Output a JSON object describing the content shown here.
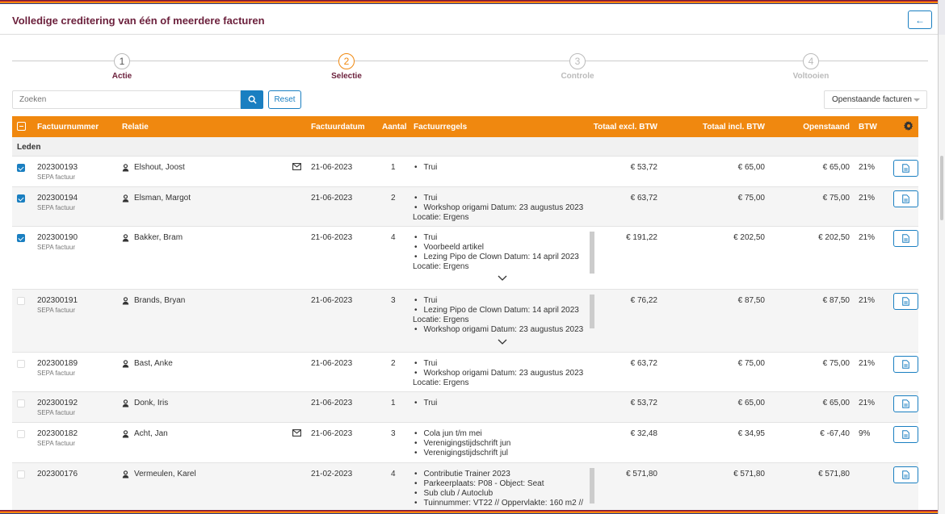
{
  "header": {
    "title": "Volledige creditering van één of meerdere facturen",
    "back_label": "←"
  },
  "steps": [
    {
      "num": "1",
      "label": "Actie"
    },
    {
      "num": "2",
      "label": "Selectie"
    },
    {
      "num": "3",
      "label": "Controle"
    },
    {
      "num": "4",
      "label": "Voltooien"
    }
  ],
  "toolbar": {
    "search_placeholder": "Zoeken",
    "reset_label": "Reset",
    "filter_value": "Openstaande facturen"
  },
  "columns": {
    "invoice": "Factuurnummer",
    "relation": "Relatie",
    "date": "Factuurdatum",
    "count": "Aantal",
    "lines": "Factuurregels",
    "excl": "Totaal excl. BTW",
    "incl": "Totaal incl. BTW",
    "open": "Openstaand",
    "btw": "BTW"
  },
  "group_label": "Leden",
  "rows": [
    {
      "checked": true,
      "number": "202300193",
      "type": "SEPA factuur",
      "relation": "Elshout, Joost",
      "mail": true,
      "date": "21-06-2023",
      "count": "1",
      "lines": [
        "Trui"
      ],
      "excl": "€ 53,72",
      "incl": "€ 65,00",
      "open": "€ 65,00",
      "btw": "21%"
    },
    {
      "checked": true,
      "number": "202300194",
      "type": "SEPA factuur",
      "relation": "Elsman, Margot",
      "mail": false,
      "date": "21-06-2023",
      "count": "2",
      "lines": [
        "Trui",
        "Workshop origami Datum: 23 augustus 2023",
        "Locatie: Ergens"
      ],
      "excl": "€ 63,72",
      "incl": "€ 75,00",
      "open": "€ 75,00",
      "btw": "21%"
    },
    {
      "checked": true,
      "number": "202300190",
      "type": "SEPA factuur",
      "relation": "Bakker, Bram",
      "mail": false,
      "date": "21-06-2023",
      "count": "4",
      "lines": [
        "Trui",
        "Voorbeeld artikel",
        "Lezing Pipo de Clown Datum: 14 april 2023",
        "Locatie: Ergens"
      ],
      "excl": "€ 191,22",
      "incl": "€ 202,50",
      "open": "€ 202,50",
      "btw": "21%"
    },
    {
      "checked": false,
      "number": "202300191",
      "type": "SEPA factuur",
      "relation": "Brands, Bryan",
      "mail": false,
      "date": "21-06-2023",
      "count": "3",
      "lines": [
        "Trui",
        "Lezing Pipo de Clown Datum: 14 april 2023",
        "Locatie: Ergens",
        "Workshop origami Datum: 23 augustus 2023"
      ],
      "excl": "€ 76,22",
      "incl": "€ 87,50",
      "open": "€ 87,50",
      "btw": "21%"
    },
    {
      "checked": false,
      "number": "202300189",
      "type": "SEPA factuur",
      "relation": "Bast, Anke",
      "mail": false,
      "date": "21-06-2023",
      "count": "2",
      "lines": [
        "Trui",
        "Workshop origami Datum: 23 augustus 2023",
        "Locatie: Ergens"
      ],
      "excl": "€ 63,72",
      "incl": "€ 75,00",
      "open": "€ 75,00",
      "btw": "21%"
    },
    {
      "checked": false,
      "number": "202300192",
      "type": "SEPA factuur",
      "relation": "Donk, Iris",
      "mail": false,
      "date": "21-06-2023",
      "count": "1",
      "lines": [
        "Trui"
      ],
      "excl": "€ 53,72",
      "incl": "€ 65,00",
      "open": "€ 65,00",
      "btw": "21%"
    },
    {
      "checked": false,
      "number": "202300182",
      "type": "SEPA factuur",
      "relation": "Acht, Jan",
      "mail": true,
      "date": "21-06-2023",
      "count": "3",
      "lines": [
        "Cola jun t/m mei",
        "Verenigingstijdschrift jun",
        "Verenigingstijdschrift jul"
      ],
      "excl": "€ 32,48",
      "incl": "€ 34,95",
      "open": "€ -67,40",
      "btw": "9%"
    },
    {
      "checked": false,
      "number": "202300176",
      "type": "",
      "relation": "Vermeulen, Karel",
      "mail": false,
      "date": "21-02-2023",
      "count": "4",
      "lines": [
        "Contributie Trainer 2023",
        "Parkeerplaats: P08 - Object: Seat",
        "Sub club / Autoclub",
        "Tuinnummer: VT22 // Oppervlakte: 160 m2 //"
      ],
      "excl": "€ 571,80",
      "incl": "€ 571,80",
      "open": "€ 571,80",
      "btw": ""
    }
  ],
  "icons": {
    "search": "search-icon",
    "settings": "gear-icon",
    "user": "user-icon",
    "mail": "mail-icon",
    "document": "document-icon",
    "expand": "chevron-down-icon"
  },
  "colors": {
    "accent": "#f0880f",
    "primary": "#1a7fc1",
    "title": "#6b1f3b"
  }
}
